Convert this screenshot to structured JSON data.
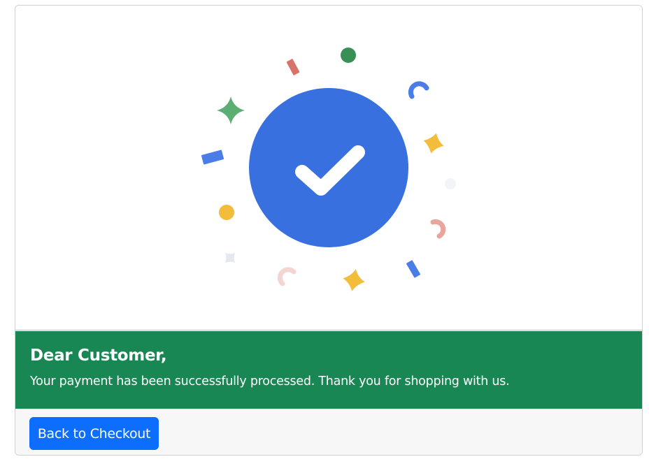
{
  "illustration": {
    "icon": "checkmark-icon",
    "circle_color": "#3870e0",
    "confetti_colors": [
      "#3a8f56",
      "#d8736a",
      "#4a7de6",
      "#f2bd3b",
      "#5cae74",
      "#e5e8ee",
      "#f4d5d1",
      "#e9a59b"
    ]
  },
  "message": {
    "title": "Dear Customer,",
    "body": "Your payment has been successfully processed. Thank you for shopping with us.",
    "background": "#198754"
  },
  "footer": {
    "back_button_label": "Back to Checkout",
    "button_color": "#0d6efd"
  }
}
